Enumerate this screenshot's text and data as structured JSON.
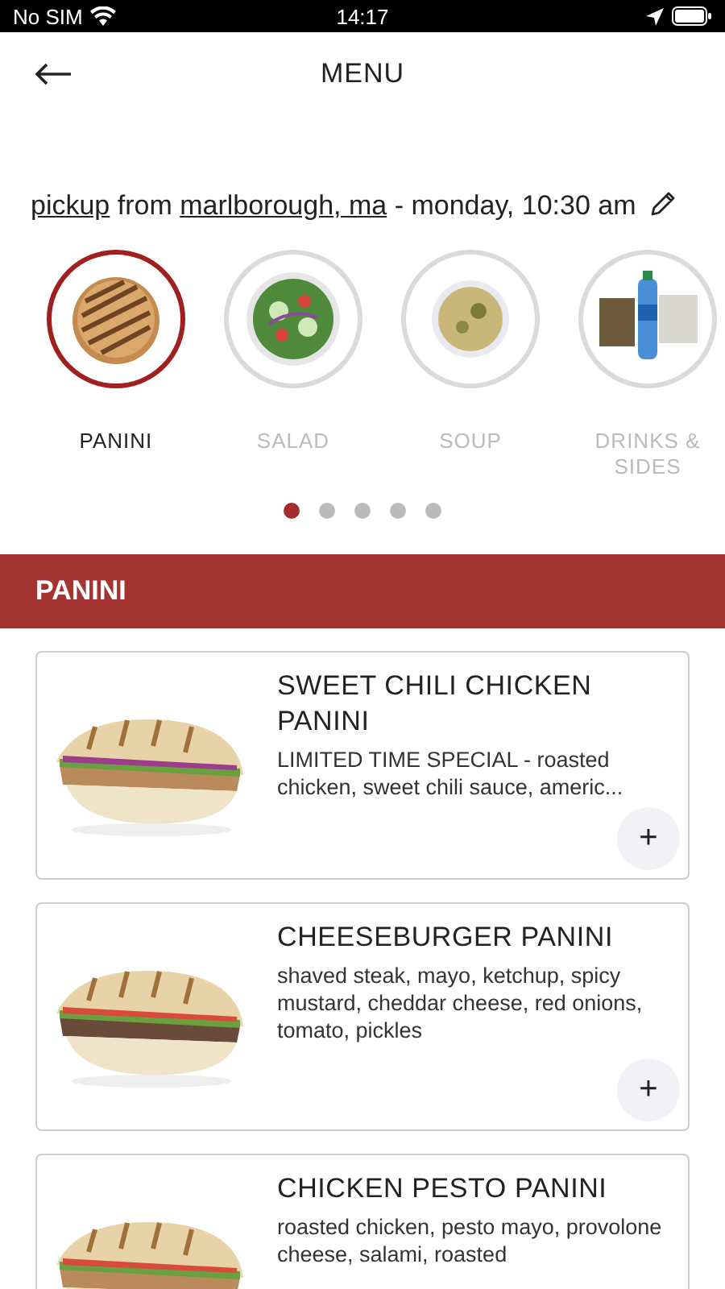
{
  "status_bar": {
    "carrier": "No SIM",
    "time": "14:17"
  },
  "header": {
    "title": "MENU"
  },
  "order": {
    "mode": "pickup",
    "from": "from",
    "location": "marlborough, ma",
    "when": "- monday, 10:30 am"
  },
  "categories": [
    {
      "label": "PANINI",
      "selected": true
    },
    {
      "label": "SALAD",
      "selected": false
    },
    {
      "label": "SOUP",
      "selected": false
    },
    {
      "label": "DRINKS & SIDES",
      "selected": false
    }
  ],
  "pager": [
    {
      "selected": true
    },
    {
      "selected": false
    },
    {
      "selected": false
    },
    {
      "selected": false
    },
    {
      "selected": false
    }
  ],
  "section": {
    "title": "PANINI"
  },
  "items": [
    {
      "name": "SWEET CHILI CHICKEN PANINI",
      "description": "LIMITED TIME SPECIAL - roasted chicken, sweet chili sauce, americ...",
      "button": "+"
    },
    {
      "name": "CHEESEBURGER PANINI",
      "description": "shaved steak, mayo, ketchup, spicy mustard, cheddar cheese, red onions, tomato, pickles",
      "button": "+"
    },
    {
      "name": "CHICKEN PESTO PANINI",
      "description": "roasted chicken, pesto mayo, provolone cheese, salami, roasted"
    }
  ]
}
